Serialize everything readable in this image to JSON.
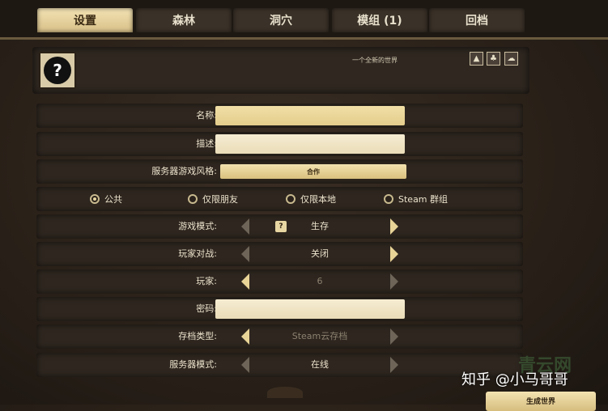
{
  "tabs": [
    {
      "label": "设置",
      "active": true
    },
    {
      "label": "森林",
      "active": false
    },
    {
      "label": "洞穴",
      "active": false
    },
    {
      "label": "模组 (1)",
      "active": false
    },
    {
      "label": "回档",
      "active": false
    }
  ],
  "world": {
    "name": "一个全新的世界",
    "icon": "question-mark-portrait-icon",
    "badge_icons": [
      "forest-icon",
      "grass-icon",
      "cloud-icon"
    ]
  },
  "form": {
    "name_label": "名称:",
    "name_value": "",
    "description_label": "描述:",
    "description_value": "",
    "style_label": "服务器游戏风格:",
    "style_value": "合作",
    "privacy_options": [
      {
        "label": "公共",
        "selected": true
      },
      {
        "label": "仅限朋友",
        "selected": false
      },
      {
        "label": "仅限本地",
        "selected": false
      },
      {
        "label": "Steam 群组",
        "selected": false
      }
    ],
    "game_mode_label": "游戏模式:",
    "game_mode_value": "生存",
    "game_mode_badge": "?",
    "pvp_label": "玩家对战:",
    "pvp_value": "关闭",
    "players_label": "玩家:",
    "players_value": "6",
    "password_label": "密码:",
    "password_value": "",
    "save_type_label": "存档类型:",
    "save_type_value": "Steam云存档",
    "server_mode_label": "服务器模式:",
    "server_mode_value": "在线"
  },
  "generate_button": "生成世界",
  "watermark": "知乎 @小马哥哥",
  "watermark_green": "青云网",
  "colors": {
    "accent_gold": "#e6d49e",
    "panel_bg": "#2e261f",
    "text": "#ece2cc"
  }
}
